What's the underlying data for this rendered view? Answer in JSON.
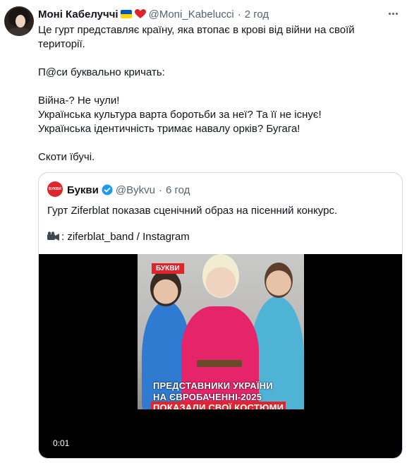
{
  "tweet": {
    "author_name": "Моні Кабелуччі",
    "handle": "@Moni_Kabelucci",
    "separator": "·",
    "time": "2 год",
    "lines": [
      "Це гурт представляє країну, яка втопає в крові від війни на своїй",
      "території.",
      "П@си буквально кричать:",
      "Війна-? Не чули!",
      "Українська культура варта боротьби за неї? Та її не існує!",
      "Українська ідентичність тримає навалу  орків? Бугага!",
      "Скоти їбучі."
    ]
  },
  "quote": {
    "logo_text": "БУКВИ",
    "author_name": "Букви",
    "handle": "@Bykvu",
    "separator": "·",
    "time": "6 год",
    "line1": "Гурт Ziferblat показав сценічний образ на пісенний конкурс.",
    "line2": ": ziferblat_band / Instagram",
    "media": {
      "tag": "БУКВИ",
      "caption_line1": "ПРЕДСТАВНИКИ УКРАЇНИ",
      "caption_line2": "НА ЄВРОБАЧЕННІ-2025",
      "caption_line3": "ПОКАЗАЛИ СВОЇ КОСТЮМИ",
      "timecode": "0:01"
    }
  },
  "colors": {
    "text": "#0f1419",
    "secondary": "#536471",
    "border": "#cfd9de",
    "brand_red": "#e0242c",
    "verified_blue": "#1d9bf0"
  },
  "icons": {
    "more": "more-horizontal-icon",
    "verified": "verified-badge-icon",
    "camera": "video-camera-icon",
    "flag": "ukraine-flag-icon",
    "heart": "red-heart-icon"
  }
}
